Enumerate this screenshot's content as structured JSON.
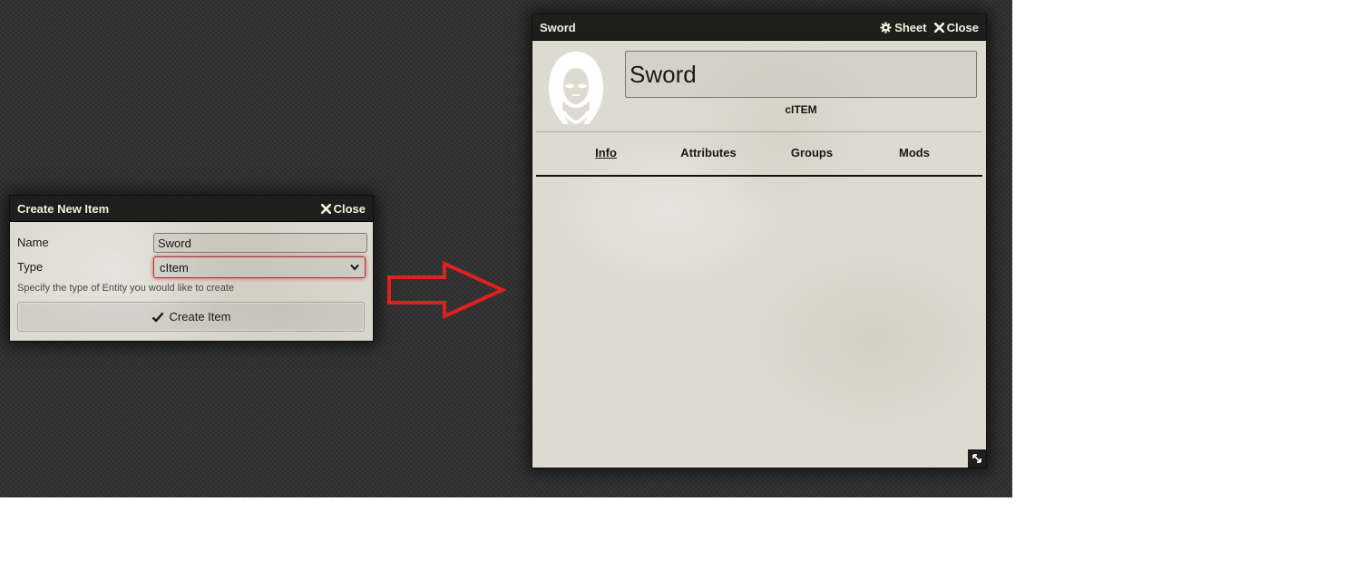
{
  "create_dialog": {
    "title": "Create New Item",
    "close_label": "Close",
    "name_label": "Name",
    "name_value": "Sword",
    "type_label": "Type",
    "type_value": "cItem",
    "hint": "Specify the type of Entity you would like to create",
    "create_button": "Create Item"
  },
  "arrow": {
    "color": "#e02020"
  },
  "item_sheet": {
    "title": "Sword",
    "sheet_label": "Sheet",
    "close_label": "Close",
    "item_name": "Sword",
    "item_type": "cITEM",
    "tabs": [
      {
        "label": "Info",
        "active": true
      },
      {
        "label": "Attributes",
        "active": false
      },
      {
        "label": "Groups",
        "active": false
      },
      {
        "label": "Mods",
        "active": false
      }
    ]
  },
  "icons": [
    "close-icon",
    "gear-icon",
    "checkmark-icon",
    "chevron-down-icon",
    "hooded-figure-icon",
    "resize-icon"
  ]
}
